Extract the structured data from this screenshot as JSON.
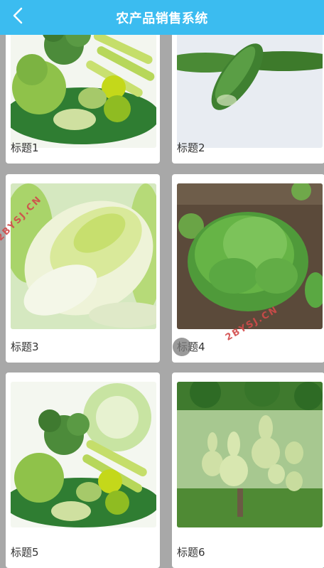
{
  "header": {
    "title": "农产品销售系统",
    "back_icon": "chevron-left-icon",
    "bg_color": "#3bbcf0"
  },
  "products": [
    {
      "label": "标题1",
      "image": "mixed-vegetables"
    },
    {
      "label": "标题2",
      "image": "cucumbers"
    },
    {
      "label": "标题3",
      "image": "napa-cabbage"
    },
    {
      "label": "标题4",
      "image": "lettuce-field"
    },
    {
      "label": "标题5",
      "image": "mixed-vegetables"
    },
    {
      "label": "标题6",
      "image": "bottle-gourds"
    }
  ],
  "watermarks": [
    "2BYSJ.CN",
    "2BYSJ.CN"
  ]
}
